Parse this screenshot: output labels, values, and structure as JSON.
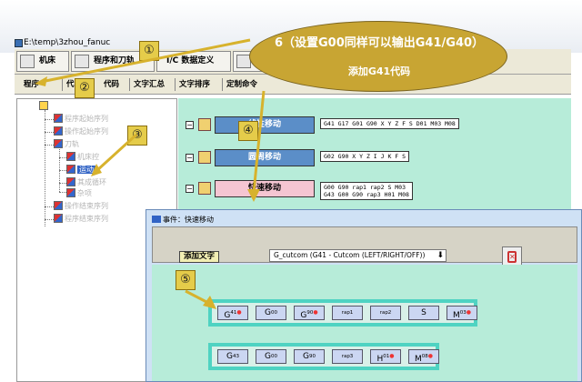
{
  "window": {
    "title": "E:\\temp\\3zhou_fanuc"
  },
  "menu": {
    "tabs": [
      "机床",
      "程序和刀轨",
      "I/C 数据定义",
      "A"
    ]
  },
  "ribbon": {
    "tabs": [
      "程序",
      "代",
      "代码",
      "文字汇总",
      "文字排序",
      "定制命令"
    ]
  },
  "tree": [
    {
      "label": "",
      "kind": "folder"
    },
    {
      "label": "程序起始序列",
      "kind": "item"
    },
    {
      "label": "操作起始序列",
      "kind": "item"
    },
    {
      "label": "刀轨",
      "kind": "item"
    },
    {
      "label": "机床控",
      "kind": "item"
    },
    {
      "label": "运动",
      "kind": "item"
    },
    {
      "label": "其成循环",
      "kind": "item"
    },
    {
      "label": "杂项",
      "kind": "item"
    },
    {
      "label": "操作结束序列",
      "kind": "item"
    },
    {
      "label": "程序结束序列",
      "kind": "item"
    }
  ],
  "blocks": [
    {
      "label": "线性移动",
      "code": "G41 G17 G01 G90 X Y Z F S D01 M03 M08"
    },
    {
      "label": "圆周移动",
      "code": "G02 G90 X Y Z I J K F S"
    },
    {
      "label": "快速移动",
      "code": "G00 G90 rap1 rap2 S M03\nG43 G00 G90 rap3 H01 M08"
    }
  ],
  "dialog": {
    "title": "事件：快速移动",
    "add_text": "添加文字",
    "combo": "G_cutcom (G41 - Cutcom (LEFT/RIGHT/OFF))",
    "row1": [
      {
        "t": "G",
        "s": "41",
        "dot": true
      },
      {
        "t": "G",
        "s": "00",
        "dot": false
      },
      {
        "t": "G",
        "s": "90",
        "dot": true
      },
      {
        "t": "",
        "s": "rap1",
        "dot": false
      },
      {
        "t": "",
        "s": "rap2",
        "dot": false
      },
      {
        "t": "S",
        "s": "",
        "dot": false
      },
      {
        "t": "M",
        "s": "03",
        "dot": true
      }
    ],
    "row2": [
      {
        "t": "G",
        "s": "43",
        "dot": false
      },
      {
        "t": "G",
        "s": "00",
        "dot": false
      },
      {
        "t": "G",
        "s": "90",
        "dot": false
      },
      {
        "t": "",
        "s": "rap3",
        "dot": false
      },
      {
        "t": "H",
        "s": "01",
        "dot": true
      },
      {
        "t": "M",
        "s": "08",
        "dot": true
      }
    ]
  },
  "annotations": {
    "callout_line1": "6（设置G00同样可以输出G41/G40）",
    "callout_line2": "添加G41代码",
    "nums": [
      "①",
      "②",
      "③",
      "④",
      "⑤"
    ]
  },
  "colors": {
    "callout": "#c8a533",
    "panel": "#b7ecd9",
    "row_border": "#4fd3c2",
    "selected_block": "#f5c5d2",
    "blue_block": "#5b8ec8"
  }
}
